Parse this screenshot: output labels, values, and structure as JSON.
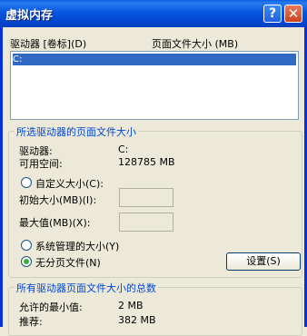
{
  "window": {
    "title": "虚拟内存",
    "help_label": "?",
    "close_label": "✕"
  },
  "drive_list": {
    "col_drive_header": "驱动器 [卷标](D)",
    "col_paging_size_header": "页面文件大小 (MB)",
    "rows": [
      {
        "drive": "C:",
        "selected": true
      }
    ]
  },
  "selected_drive": {
    "group_title": "所选驱动器的页面文件大小",
    "drive_label": "驱动器:",
    "drive_value": "C:",
    "free_space_label": "可用空间:",
    "free_space_value": "128785 MB",
    "custom_size_label": "自定义大小(C):",
    "initial_size_label": "初始大小(MB)(I):",
    "initial_size_value": "",
    "max_size_label": "最大值(MB)(X):",
    "max_size_value": "",
    "system_managed_label": "系统管理的大小(Y)",
    "no_paging_label": "无分页文件(N)",
    "selected_option": "no_paging",
    "set_button_label": "设置(S)"
  },
  "totals": {
    "group_title": "所有驱动器页面文件大小的总数",
    "min_allowed_label": "允许的最小值:",
    "min_allowed_value": "2 MB",
    "recommended_label": "推荐:",
    "recommended_value": "382 MB"
  },
  "colors": {
    "title_bar": "#0554dc",
    "selection": "#316ac5",
    "group_title": "#0046d5",
    "dialog_bg": "#ece9d8"
  }
}
